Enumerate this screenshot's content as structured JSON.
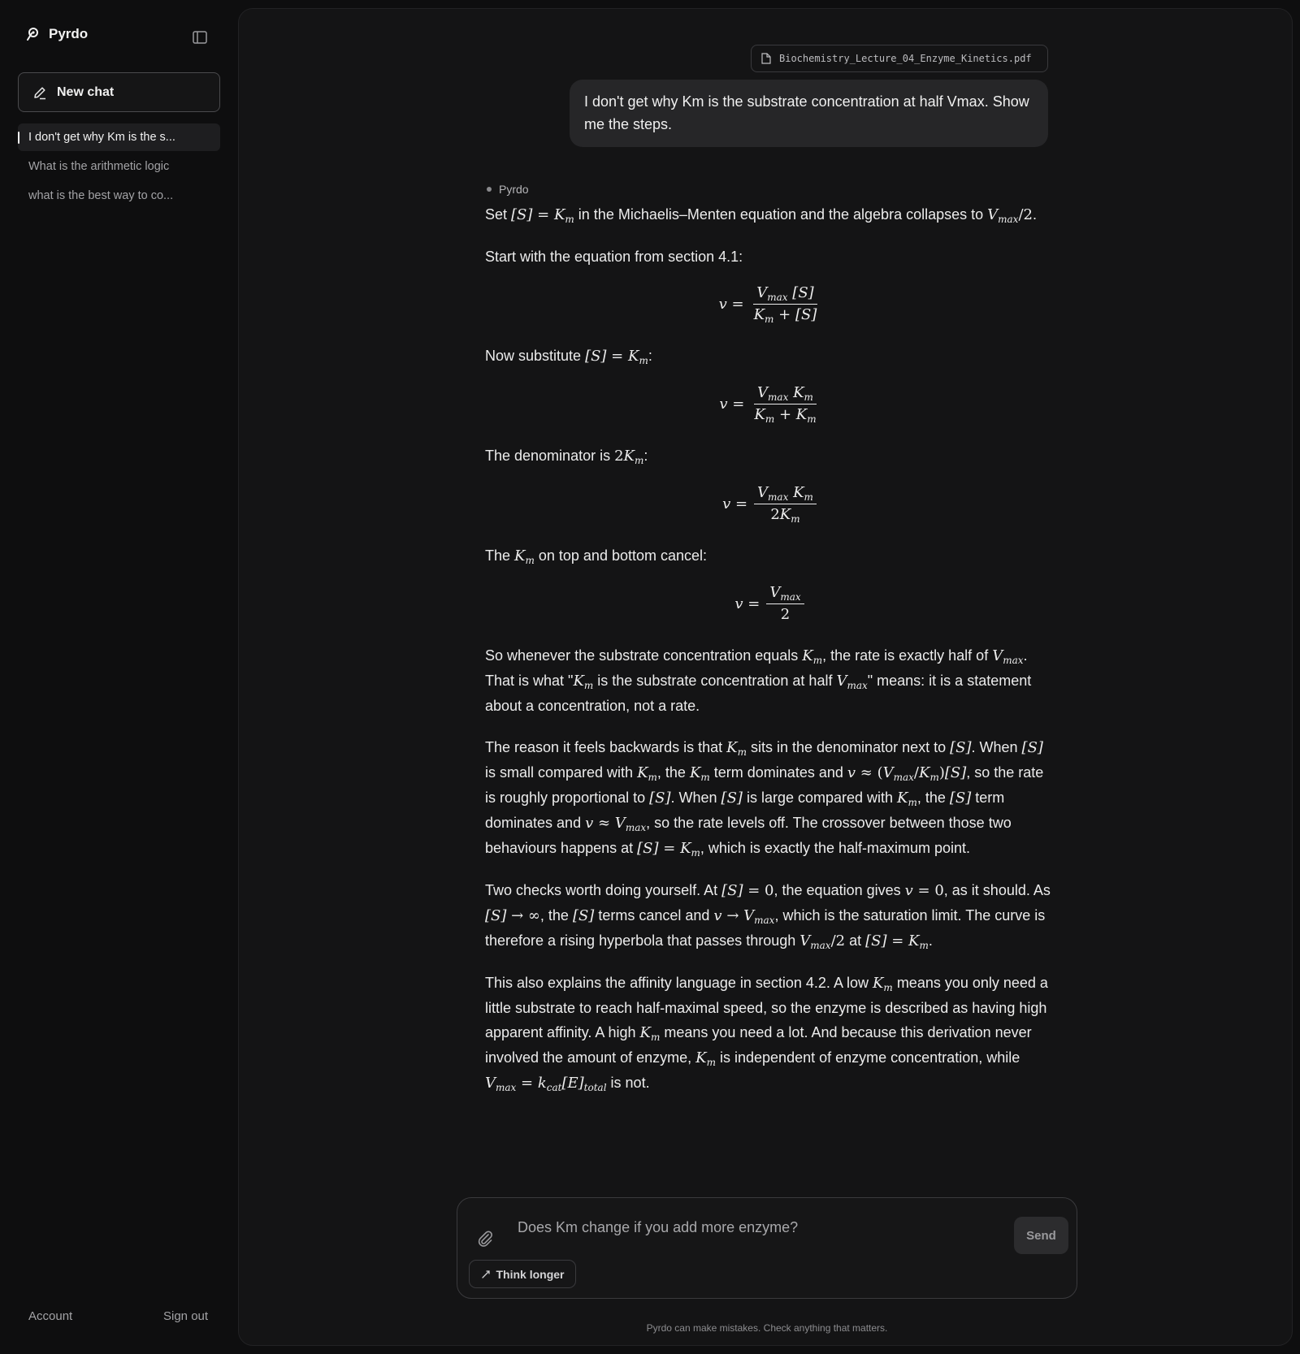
{
  "app": {
    "name": "Pyrdo"
  },
  "sidebar": {
    "new_chat_label": "New chat",
    "history": [
      {
        "label": "I don't get why Km is the s..."
      },
      {
        "label": "What is the arithmetic logic"
      },
      {
        "label": "what is the best way to co..."
      }
    ],
    "account_label": "Account",
    "signout_label": "Sign out"
  },
  "conversation": {
    "attachment_name": "Biochemistry_Lecture_04_Enzyme_Kinetics.pdf",
    "user_message": "I don't get why Km is the substrate concentration at half Vmax. Show me the steps.",
    "assistant_name": "Pyrdo",
    "answer": {
      "p1": {
        "a": "Set ",
        "b": " in the Michaelis–Menten equation and the algebra collapses to "
      },
      "p2": "Start with the equation from section 4.1:",
      "p3": "Now substitute ",
      "p4": "The denominator is ",
      "p5": {
        "a": "The ",
        "b": " on top and bottom cancel:"
      },
      "p6": {
        "a": "So whenever the substrate concentration equals ",
        "b": ", the rate is exactly half of ",
        "c": ". That is what \"",
        "d": " is the substrate concentration at half ",
        "e": "\" means: it is a statement about a concentration, not a rate."
      },
      "p7": {
        "a": "The reason it feels backwards is that ",
        "b": " sits in the denominator next to ",
        "c": ". When ",
        "d": " is small compared with ",
        "e": ", the ",
        "f": " term dominates and ",
        "g": ", so the rate is roughly proportional to ",
        "h": ". When ",
        "i": " is large compared with ",
        "j": ", the ",
        "k": " term dominates and ",
        "l": ", so the rate levels off. The crossover between those two behaviours happens at ",
        "m": ", which is exactly the half-maximum point."
      },
      "p8": {
        "a": "Two checks worth doing yourself. At ",
        "b": ", the equation gives ",
        "c": ", as it should. As ",
        "d": ", the ",
        "e": " terms cancel and ",
        "f": ", which is the saturation limit. The curve is therefore a rising hyperbola that passes through ",
        "g": " at "
      },
      "p9": {
        "a": "This also explains the affinity language in section 4.2. A low ",
        "b": " means you only need a little substrate to reach half-maximal speed, so the enzyme is described as having high apparent affinity. A high ",
        "c": " means you need a lot. And because this derivation never involved the amount of enzyme, ",
        "d": " is independent of enzyme concentration, while ",
        "e": " is not."
      }
    }
  },
  "composer": {
    "placeholder": "Does Km change if you add more enzyme?",
    "send_label": "Send",
    "think_label": "Think longer"
  },
  "footer": {
    "disclaimer": "Pyrdo can make mistakes. Check anything that matters."
  }
}
